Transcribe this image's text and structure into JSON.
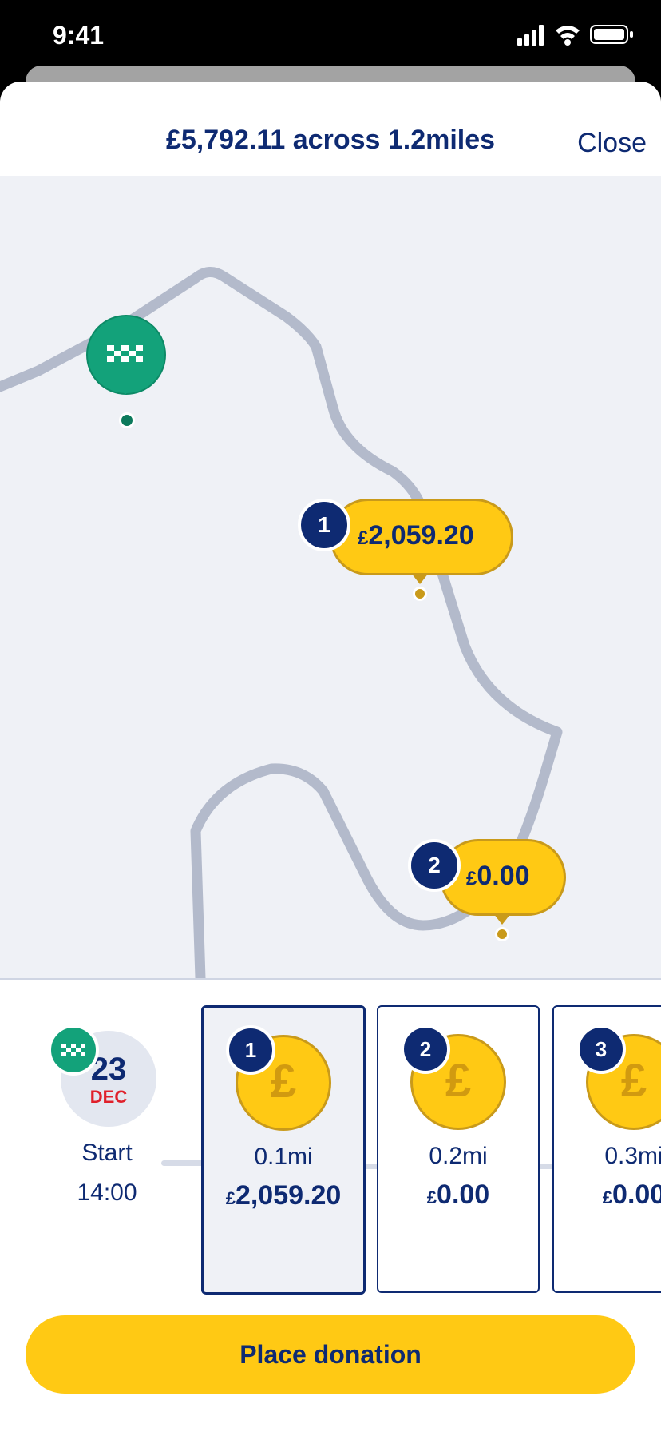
{
  "status_bar": {
    "time": "9:41"
  },
  "header": {
    "title": "£5,792.11 across 1.2miles",
    "close_label": "Close"
  },
  "map": {
    "start_marker_icon": "checkered-flag-icon",
    "markers": [
      {
        "number": "1",
        "currency": "£",
        "amount": "2,059.20"
      },
      {
        "number": "2",
        "currency": "£",
        "amount": "0.00"
      }
    ]
  },
  "timeline": {
    "start": {
      "day": "23",
      "month": "DEC",
      "label": "Start",
      "time": "14:00",
      "icon": "checkered-flag-icon"
    },
    "steps": [
      {
        "number": "1",
        "distance": "0.1mi",
        "currency": "£",
        "amount": "2,059.20",
        "icon": "pound-coin-icon",
        "selected": true
      },
      {
        "number": "2",
        "distance": "0.2mi",
        "currency": "£",
        "amount": "0.00",
        "icon": "pound-coin-icon",
        "selected": false
      },
      {
        "number": "3",
        "distance": "0.3mi",
        "currency": "£",
        "amount": "0.00",
        "icon": "pound-coin-icon",
        "selected": false
      }
    ]
  },
  "cta": {
    "label": "Place donation"
  },
  "colors": {
    "navy": "#0e2a72",
    "yellow": "#ffc914",
    "green": "#13a27a",
    "route": "#b3bacb",
    "red": "#e0202b"
  }
}
